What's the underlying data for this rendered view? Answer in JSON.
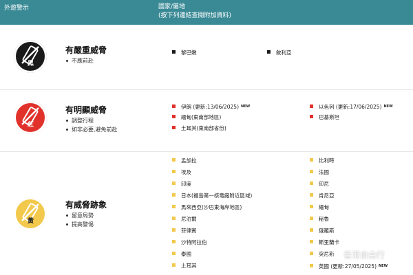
{
  "header": {
    "col1_title": "外遊警示",
    "col2_title": "國家/屬地",
    "col2_subtitle": "(按下列連結查閱附加資料)"
  },
  "levels": {
    "black": {
      "badge_char": "黑",
      "title": "有嚴重威脅",
      "advice": [
        "不應前赴"
      ],
      "color": "#1a1a1a",
      "places_left": [
        {
          "name": "黎巴嫩"
        }
      ],
      "places_right": [
        {
          "name": "敘利亞"
        }
      ]
    },
    "red": {
      "badge_char": "紅",
      "title": "有明顯威脅",
      "advice": [
        "調整行程",
        "如非必要,避免前赴"
      ],
      "color": "#e0322b",
      "places_left": [
        {
          "name": "伊朗 (更新:13/06/2025)",
          "new": "NEW"
        },
        {
          "name": "緬甸(東南部地區)"
        },
        {
          "name": "土耳其(東南部省份)"
        }
      ],
      "places_right": [
        {
          "name": "以色列 (更新:17/06/2025)",
          "new": "NEW"
        },
        {
          "name": "巴基斯坦"
        }
      ]
    },
    "amber": {
      "badge_char": "黃",
      "title": "有威脅跡象",
      "advice": [
        "留意局勢",
        "提高警惕"
      ],
      "color": "#f2c94c",
      "places_left": [
        {
          "name": "孟加拉"
        },
        {
          "name": "埃及"
        },
        {
          "name": "印度"
        },
        {
          "name": "日本(福島第一核電廠附近區域)"
        },
        {
          "name": "馬來西亞(沙巴東海岸地區)"
        },
        {
          "name": "尼泊爾"
        },
        {
          "name": "菲律賓"
        },
        {
          "name": "沙特阿拉伯"
        },
        {
          "name": "泰國"
        },
        {
          "name": "土耳其"
        }
      ],
      "places_right": [
        {
          "name": "比利時"
        },
        {
          "name": "法國"
        },
        {
          "name": "印尼"
        },
        {
          "name": "肯尼亞"
        },
        {
          "name": "緬甸"
        },
        {
          "name": "秘魯"
        },
        {
          "name": "俄羅斯"
        },
        {
          "name": "斯里蘭卡"
        },
        {
          "name": "突尼斯"
        },
        {
          "name": "英國 (更新:27/05/2025)",
          "new": "NEW"
        }
      ]
    }
  },
  "watermark": "香港自由行",
  "colors": {
    "header_bg": "#3a8a96"
  }
}
